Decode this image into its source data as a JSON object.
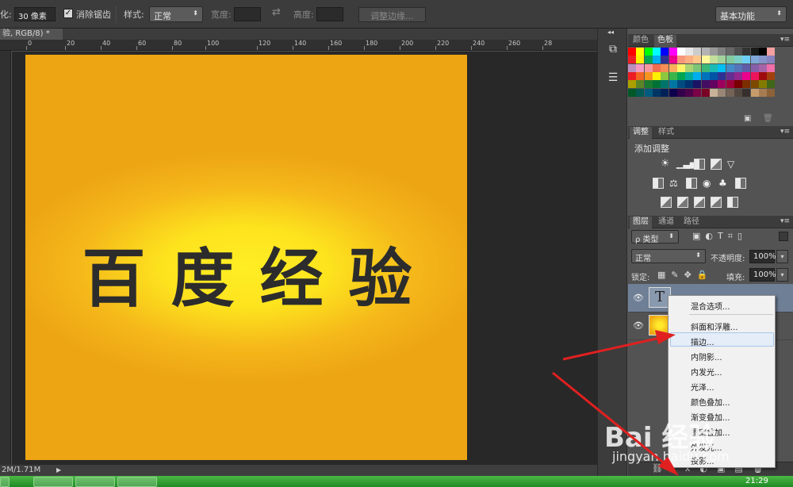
{
  "options_bar": {
    "feather_prefix": "化:",
    "feather_value": "30 像素",
    "antialias_label": "消除锯齿",
    "antialias_checked": true,
    "style_label": "样式:",
    "style_value": "正常",
    "width_label": "宽度:",
    "height_label": "高度:",
    "refine_edge_button": "调整边缘...",
    "workspace_value": "基本功能"
  },
  "document": {
    "tab_title": "验, RGB/8) *",
    "tab_close": "×",
    "canvas_text": "百度经验",
    "status_text": "2M/1.71M"
  },
  "ruler": {
    "h_ticks": [
      "0",
      "20",
      "40",
      "60",
      "80",
      "100",
      "120",
      "140",
      "160",
      "180",
      "200",
      "220",
      "240",
      "260",
      "28"
    ]
  },
  "panels": {
    "swatch_tabs": [
      "颜色",
      "色板"
    ],
    "adjust_tabs": [
      "调整",
      "样式"
    ],
    "adjust_title": "添加调整",
    "layers_tabs": [
      "图层",
      "通道",
      "路径"
    ],
    "kind_filter": "ρ 类型",
    "blend_mode": "正常",
    "opacity_label": "不透明度:",
    "opacity_value": "100%",
    "lock_label": "锁定:",
    "fill_label": "填充:",
    "fill_value": "100%",
    "text_layer_thumb": "T"
  },
  "context_menu": {
    "items": [
      "混合选项...",
      "斜面和浮雕...",
      "描边...",
      "内阴影...",
      "内发光...",
      "光泽...",
      "颜色叠加...",
      "渐变叠加...",
      "图案叠加...",
      "外发光...",
      "投影..."
    ],
    "highlighted_index": 2
  },
  "watermark": {
    "brand": "Bai 经验",
    "url": "jingyan.baidu.com"
  },
  "taskbar": {
    "clock": "21:29"
  },
  "colors": {
    "arrow": "#e02020",
    "canvas_center": "#ffee24",
    "canvas_edge": "#eda514",
    "text": "#2c2c2c"
  }
}
